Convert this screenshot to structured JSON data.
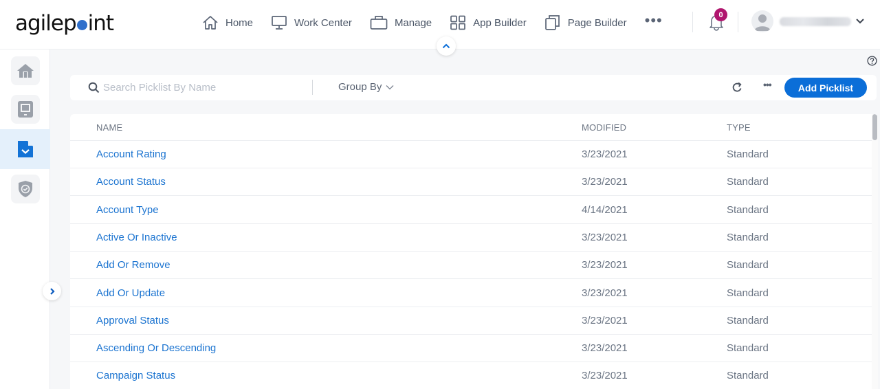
{
  "app": {
    "logo": {
      "pre": "agilep",
      "post": "int"
    }
  },
  "nav": {
    "items": [
      {
        "label": "Home",
        "icon": "home-icon"
      },
      {
        "label": "Work Center",
        "icon": "monitor-icon"
      },
      {
        "label": "Manage",
        "icon": "briefcase-icon"
      },
      {
        "label": "App Builder",
        "icon": "grid-icon"
      },
      {
        "label": "Page Builder",
        "icon": "copy-icon"
      }
    ],
    "more": "•••"
  },
  "notifications": {
    "count": "0"
  },
  "sidebar": {
    "items": [
      {
        "name": "home",
        "icon": "home-icon",
        "active": false
      },
      {
        "name": "work-center",
        "icon": "tablet-icon",
        "active": false
      },
      {
        "name": "picklists",
        "icon": "document-check-icon",
        "active": true
      },
      {
        "name": "security",
        "icon": "shield-check-icon",
        "active": false
      }
    ]
  },
  "toolbar": {
    "search_placeholder": "Search Picklist By Name",
    "search_value": "",
    "group_by_label": "Group By",
    "more_label": "•••",
    "add_label": "Add Picklist"
  },
  "table": {
    "columns": [
      "NAME",
      "MODIFIED",
      "TYPE"
    ],
    "rows": [
      {
        "name": "Account Rating",
        "modified": "3/23/2021",
        "type": "Standard"
      },
      {
        "name": "Account Status",
        "modified": "3/23/2021",
        "type": "Standard"
      },
      {
        "name": "Account Type",
        "modified": "4/14/2021",
        "type": "Standard"
      },
      {
        "name": "Active Or Inactive",
        "modified": "3/23/2021",
        "type": "Standard"
      },
      {
        "name": "Add Or Remove",
        "modified": "3/23/2021",
        "type": "Standard"
      },
      {
        "name": "Add Or Update",
        "modified": "3/23/2021",
        "type": "Standard"
      },
      {
        "name": "Approval Status",
        "modified": "3/23/2021",
        "type": "Standard"
      },
      {
        "name": "Ascending Or Descending",
        "modified": "3/23/2021",
        "type": "Standard"
      },
      {
        "name": "Campaign Status",
        "modified": "3/23/2021",
        "type": "Standard"
      }
    ]
  },
  "colors": {
    "accent": "#0b6ed8",
    "link": "#1a73d0",
    "badge": "#b0166e",
    "logo_dot": "#2f6fcb"
  }
}
